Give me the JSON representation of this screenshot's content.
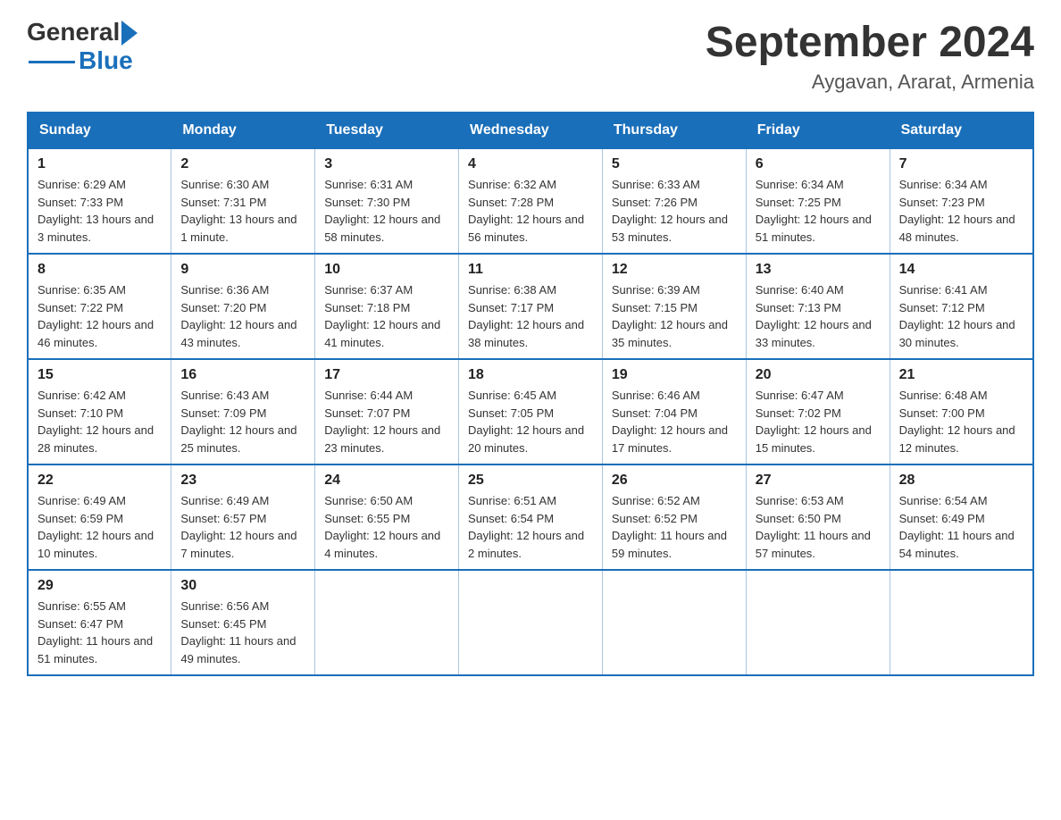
{
  "header": {
    "logo_general": "General",
    "logo_blue": "Blue",
    "month_year": "September 2024",
    "location": "Aygavan, Ararat, Armenia"
  },
  "weekdays": [
    "Sunday",
    "Monday",
    "Tuesday",
    "Wednesday",
    "Thursday",
    "Friday",
    "Saturday"
  ],
  "weeks": [
    [
      {
        "day": "1",
        "sunrise": "Sunrise: 6:29 AM",
        "sunset": "Sunset: 7:33 PM",
        "daylight": "Daylight: 13 hours and 3 minutes."
      },
      {
        "day": "2",
        "sunrise": "Sunrise: 6:30 AM",
        "sunset": "Sunset: 7:31 PM",
        "daylight": "Daylight: 13 hours and 1 minute."
      },
      {
        "day": "3",
        "sunrise": "Sunrise: 6:31 AM",
        "sunset": "Sunset: 7:30 PM",
        "daylight": "Daylight: 12 hours and 58 minutes."
      },
      {
        "day": "4",
        "sunrise": "Sunrise: 6:32 AM",
        "sunset": "Sunset: 7:28 PM",
        "daylight": "Daylight: 12 hours and 56 minutes."
      },
      {
        "day": "5",
        "sunrise": "Sunrise: 6:33 AM",
        "sunset": "Sunset: 7:26 PM",
        "daylight": "Daylight: 12 hours and 53 minutes."
      },
      {
        "day": "6",
        "sunrise": "Sunrise: 6:34 AM",
        "sunset": "Sunset: 7:25 PM",
        "daylight": "Daylight: 12 hours and 51 minutes."
      },
      {
        "day": "7",
        "sunrise": "Sunrise: 6:34 AM",
        "sunset": "Sunset: 7:23 PM",
        "daylight": "Daylight: 12 hours and 48 minutes."
      }
    ],
    [
      {
        "day": "8",
        "sunrise": "Sunrise: 6:35 AM",
        "sunset": "Sunset: 7:22 PM",
        "daylight": "Daylight: 12 hours and 46 minutes."
      },
      {
        "day": "9",
        "sunrise": "Sunrise: 6:36 AM",
        "sunset": "Sunset: 7:20 PM",
        "daylight": "Daylight: 12 hours and 43 minutes."
      },
      {
        "day": "10",
        "sunrise": "Sunrise: 6:37 AM",
        "sunset": "Sunset: 7:18 PM",
        "daylight": "Daylight: 12 hours and 41 minutes."
      },
      {
        "day": "11",
        "sunrise": "Sunrise: 6:38 AM",
        "sunset": "Sunset: 7:17 PM",
        "daylight": "Daylight: 12 hours and 38 minutes."
      },
      {
        "day": "12",
        "sunrise": "Sunrise: 6:39 AM",
        "sunset": "Sunset: 7:15 PM",
        "daylight": "Daylight: 12 hours and 35 minutes."
      },
      {
        "day": "13",
        "sunrise": "Sunrise: 6:40 AM",
        "sunset": "Sunset: 7:13 PM",
        "daylight": "Daylight: 12 hours and 33 minutes."
      },
      {
        "day": "14",
        "sunrise": "Sunrise: 6:41 AM",
        "sunset": "Sunset: 7:12 PM",
        "daylight": "Daylight: 12 hours and 30 minutes."
      }
    ],
    [
      {
        "day": "15",
        "sunrise": "Sunrise: 6:42 AM",
        "sunset": "Sunset: 7:10 PM",
        "daylight": "Daylight: 12 hours and 28 minutes."
      },
      {
        "day": "16",
        "sunrise": "Sunrise: 6:43 AM",
        "sunset": "Sunset: 7:09 PM",
        "daylight": "Daylight: 12 hours and 25 minutes."
      },
      {
        "day": "17",
        "sunrise": "Sunrise: 6:44 AM",
        "sunset": "Sunset: 7:07 PM",
        "daylight": "Daylight: 12 hours and 23 minutes."
      },
      {
        "day": "18",
        "sunrise": "Sunrise: 6:45 AM",
        "sunset": "Sunset: 7:05 PM",
        "daylight": "Daylight: 12 hours and 20 minutes."
      },
      {
        "day": "19",
        "sunrise": "Sunrise: 6:46 AM",
        "sunset": "Sunset: 7:04 PM",
        "daylight": "Daylight: 12 hours and 17 minutes."
      },
      {
        "day": "20",
        "sunrise": "Sunrise: 6:47 AM",
        "sunset": "Sunset: 7:02 PM",
        "daylight": "Daylight: 12 hours and 15 minutes."
      },
      {
        "day": "21",
        "sunrise": "Sunrise: 6:48 AM",
        "sunset": "Sunset: 7:00 PM",
        "daylight": "Daylight: 12 hours and 12 minutes."
      }
    ],
    [
      {
        "day": "22",
        "sunrise": "Sunrise: 6:49 AM",
        "sunset": "Sunset: 6:59 PM",
        "daylight": "Daylight: 12 hours and 10 minutes."
      },
      {
        "day": "23",
        "sunrise": "Sunrise: 6:49 AM",
        "sunset": "Sunset: 6:57 PM",
        "daylight": "Daylight: 12 hours and 7 minutes."
      },
      {
        "day": "24",
        "sunrise": "Sunrise: 6:50 AM",
        "sunset": "Sunset: 6:55 PM",
        "daylight": "Daylight: 12 hours and 4 minutes."
      },
      {
        "day": "25",
        "sunrise": "Sunrise: 6:51 AM",
        "sunset": "Sunset: 6:54 PM",
        "daylight": "Daylight: 12 hours and 2 minutes."
      },
      {
        "day": "26",
        "sunrise": "Sunrise: 6:52 AM",
        "sunset": "Sunset: 6:52 PM",
        "daylight": "Daylight: 11 hours and 59 minutes."
      },
      {
        "day": "27",
        "sunrise": "Sunrise: 6:53 AM",
        "sunset": "Sunset: 6:50 PM",
        "daylight": "Daylight: 11 hours and 57 minutes."
      },
      {
        "day": "28",
        "sunrise": "Sunrise: 6:54 AM",
        "sunset": "Sunset: 6:49 PM",
        "daylight": "Daylight: 11 hours and 54 minutes."
      }
    ],
    [
      {
        "day": "29",
        "sunrise": "Sunrise: 6:55 AM",
        "sunset": "Sunset: 6:47 PM",
        "daylight": "Daylight: 11 hours and 51 minutes."
      },
      {
        "day": "30",
        "sunrise": "Sunrise: 6:56 AM",
        "sunset": "Sunset: 6:45 PM",
        "daylight": "Daylight: 11 hours and 49 minutes."
      },
      null,
      null,
      null,
      null,
      null
    ]
  ]
}
